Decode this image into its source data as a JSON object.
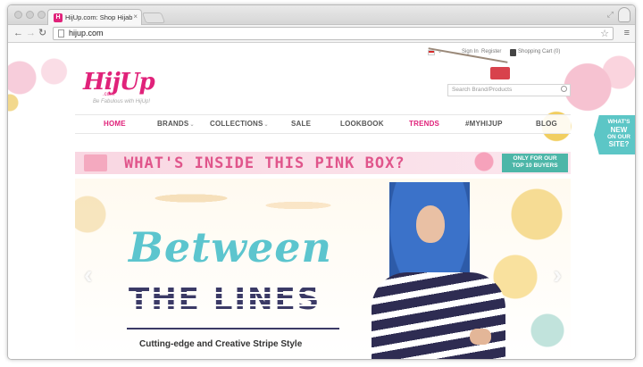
{
  "browser": {
    "tab_title": "HijUp.com: Shop Hijab Fashion",
    "tab_close": "×",
    "url": "hijup.com"
  },
  "site": {
    "logo_text": "HijUp",
    "logo_sub": ".com",
    "tagline": "Be Fabulous with HijUp!",
    "signin": "Sign In",
    "register": "Register",
    "cart": "Shopping Cart (0)",
    "search_placeholder": "Search Brand/Products"
  },
  "nav": {
    "items": [
      {
        "label": "HOME",
        "active": true
      },
      {
        "label": "BRANDS",
        "caret": "⌄"
      },
      {
        "label": "COLLECTIONS",
        "caret": "⌄"
      },
      {
        "label": "SALE"
      },
      {
        "label": "LOOKBOOK"
      },
      {
        "label": "TRENDS",
        "active": true
      },
      {
        "label": "#MYHIJUP"
      },
      {
        "label": "BLOG"
      }
    ]
  },
  "badge": {
    "line1": "WHAT'S",
    "line2": "NEW",
    "line3": "ON OUR",
    "line4": "SITE?"
  },
  "promo": {
    "text": "WHAT'S INSIDE THIS PINK BOX?",
    "badge_line1": "ONLY FOR OUR",
    "badge_line2": "TOP 10 BUYERS"
  },
  "hero": {
    "title_line1": "Between",
    "title_line2": "THE LINES",
    "subtitle": "Cutting-edge and Creative Stripe Style",
    "prev_arrow": "‹",
    "next_arrow": "›"
  },
  "colors": {
    "brand_pink": "#e0227a",
    "teal": "#5cc5ce",
    "navy": "#3b3a66"
  }
}
